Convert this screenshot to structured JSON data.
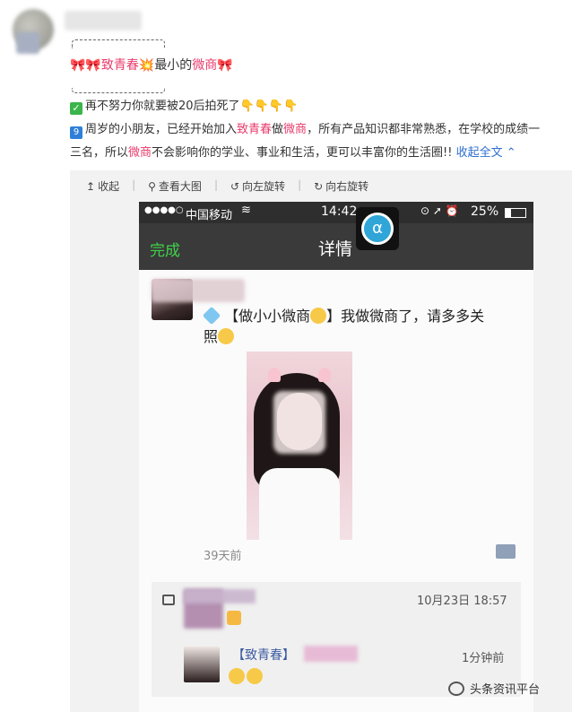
{
  "post": {
    "title_parts": {
      "pre": "🎀🎀",
      "brand": "致青春",
      "burst": "💥",
      "mid": "最小的",
      "tag": "微商",
      "post": "🎀"
    },
    "line1": {
      "text": "再不努力你就要被20后拍死了",
      "points": "👇👇👇👇"
    },
    "line2": {
      "a": "周岁的小朋友，已经开始加入",
      "brand": "致青春",
      "b": "做",
      "tag": "微商",
      "c": "，所有产品知识都非常熟悉，在学校的成绩一"
    },
    "line3": {
      "a": "三名，所以",
      "tag": "微商",
      "b": "不会影响你的学业、事业和生活，更可以丰富你的生活圈!! ",
      "collapse": "收起全文"
    }
  },
  "toolbar": {
    "collapse": "收起",
    "view_large": "查看大图",
    "rotate_left": "向左旋转",
    "rotate_right": "向右旋转"
  },
  "phone": {
    "signal": "●●●●○",
    "carrier": "中国移动",
    "time": "14:42",
    "battery": "25%",
    "nav_done": "完成",
    "nav_title": "详情",
    "alpha_glyph": "α"
  },
  "moment": {
    "text_pre": "【做小小微商",
    "text_mid": "】我做微商了，请多多关",
    "text_end": "照",
    "age": "39天前"
  },
  "comments": [
    {
      "time": "10月23日 18:57"
    },
    {
      "name": "【致青春】",
      "time": "1分钟前"
    }
  ],
  "watermark": "头条资讯平台",
  "colors": {
    "highlight": "#e83b6b",
    "link": "#2f6fcf",
    "wechat_green": "#3fd14a"
  }
}
